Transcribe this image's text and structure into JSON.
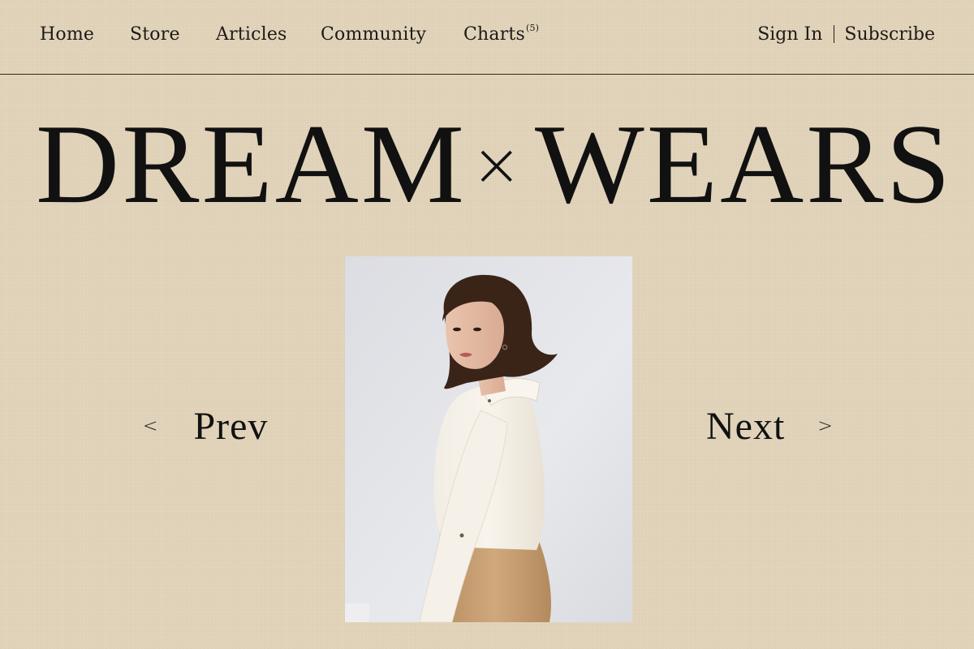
{
  "nav": {
    "home": "Home",
    "store": "Store",
    "articles": "Articles",
    "community": "Community",
    "charts": "Charts",
    "charts_count": "(5)",
    "sign_in": "Sign In",
    "subscribe": "Subscribe"
  },
  "hero": {
    "title_left": "DREAM",
    "separator": "×",
    "title_right": "WEARS"
  },
  "pager": {
    "prev_label": "Prev",
    "next_label": "Next",
    "prev_icon": "chevron-left-icon",
    "next_icon": "chevron-right-icon"
  },
  "colors": {
    "background": "#e2d5bb",
    "text": "#151310",
    "photo_backdrop": "#e3e4e8",
    "blouse": "#f4efe6",
    "skirt": "#c9a47a",
    "hair": "#3a2418"
  }
}
